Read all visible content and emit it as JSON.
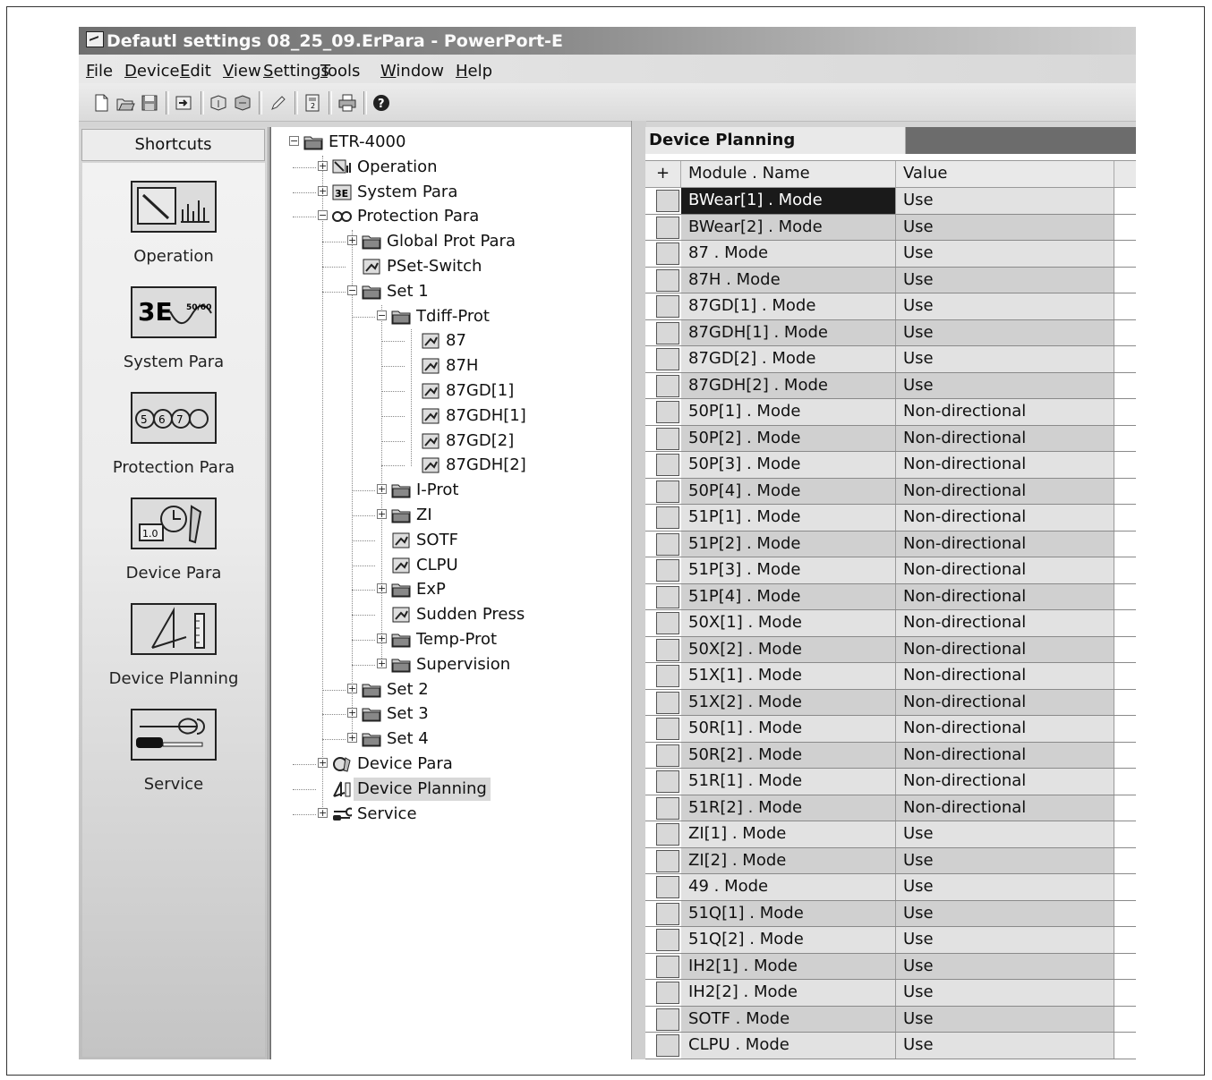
{
  "window": {
    "title": "Defautl settings 08_25_09.ErPara - PowerPort-E"
  },
  "menu": [
    {
      "pre": "",
      "ul": "F",
      "post": "ile"
    },
    {
      "pre": "",
      "ul": "D",
      "post": "evice"
    },
    {
      "pre": "",
      "ul": "E",
      "post": "dit"
    },
    {
      "pre": "",
      "ul": "V",
      "post": "iew"
    },
    {
      "pre": "",
      "ul": "S",
      "post": "ettings"
    },
    {
      "pre": "",
      "ul": "T",
      "post": "ools"
    },
    {
      "pre": "",
      "ul": "W",
      "post": "indow"
    },
    {
      "pre": "",
      "ul": "H",
      "post": "elp"
    }
  ],
  "shortcuts": {
    "header": "Shortcuts",
    "items": [
      {
        "label": "Operation",
        "icon": "operation-icon"
      },
      {
        "label": "System Para",
        "icon": "system-para-icon"
      },
      {
        "label": "Protection Para",
        "icon": "protection-para-icon"
      },
      {
        "label": "Device Para",
        "icon": "device-para-icon"
      },
      {
        "label": "Device Planning",
        "icon": "device-planning-icon"
      },
      {
        "label": "Service",
        "icon": "service-icon"
      }
    ]
  },
  "tree": [
    {
      "label": "ETR-4000",
      "level": 0,
      "exp": "-",
      "icon": "folder"
    },
    {
      "label": "Operation",
      "level": 1,
      "exp": "+",
      "icon": "operation"
    },
    {
      "label": "System Para",
      "level": 1,
      "exp": "+",
      "icon": "system"
    },
    {
      "label": "Protection Para",
      "level": 1,
      "exp": "-",
      "icon": "protection"
    },
    {
      "label": "Global Prot Para",
      "level": 2,
      "exp": "+",
      "icon": "folder"
    },
    {
      "label": "PSet-Switch",
      "level": 2,
      "exp": "",
      "icon": "param"
    },
    {
      "label": "Set 1",
      "level": 2,
      "exp": "-",
      "icon": "folder"
    },
    {
      "label": "Tdiff-Prot",
      "level": 3,
      "exp": "-",
      "icon": "folder"
    },
    {
      "label": "87",
      "level": 4,
      "exp": "",
      "icon": "param"
    },
    {
      "label": "87H",
      "level": 4,
      "exp": "",
      "icon": "param"
    },
    {
      "label": "87GD[1]",
      "level": 4,
      "exp": "",
      "icon": "param"
    },
    {
      "label": "87GDH[1]",
      "level": 4,
      "exp": "",
      "icon": "param"
    },
    {
      "label": "87GD[2]",
      "level": 4,
      "exp": "",
      "icon": "param"
    },
    {
      "label": "87GDH[2]",
      "level": 4,
      "exp": "",
      "icon": "param"
    },
    {
      "label": "I-Prot",
      "level": 3,
      "exp": "+",
      "icon": "folder"
    },
    {
      "label": "ZI",
      "level": 3,
      "exp": "+",
      "icon": "folder"
    },
    {
      "label": "SOTF",
      "level": 3,
      "exp": "",
      "icon": "param"
    },
    {
      "label": "CLPU",
      "level": 3,
      "exp": "",
      "icon": "param"
    },
    {
      "label": "ExP",
      "level": 3,
      "exp": "+",
      "icon": "folder"
    },
    {
      "label": "Sudden Press",
      "level": 3,
      "exp": "",
      "icon": "param"
    },
    {
      "label": "Temp-Prot",
      "level": 3,
      "exp": "+",
      "icon": "folder"
    },
    {
      "label": "Supervision",
      "level": 3,
      "exp": "+",
      "icon": "folder"
    },
    {
      "label": "Set 2",
      "level": 2,
      "exp": "+",
      "icon": "folder"
    },
    {
      "label": "Set 3",
      "level": 2,
      "exp": "+",
      "icon": "folder"
    },
    {
      "label": "Set 4",
      "level": 2,
      "exp": "+",
      "icon": "folder"
    },
    {
      "label": "Device Para",
      "level": 1,
      "exp": "+",
      "icon": "devpara"
    },
    {
      "label": "Device Planning",
      "level": 1,
      "exp": "",
      "icon": "devplan",
      "selected": true
    },
    {
      "label": "Service",
      "level": 1,
      "exp": "+",
      "icon": "service"
    }
  ],
  "grid": {
    "title": "Device Planning",
    "headers": {
      "plus": "+",
      "name": "Module . Name",
      "value": "Value"
    },
    "rows": [
      {
        "name": "BWear[1] . Mode",
        "value": "Use"
      },
      {
        "name": "BWear[2] . Mode",
        "value": "Use"
      },
      {
        "name": "87 . Mode",
        "value": "Use"
      },
      {
        "name": "87H . Mode",
        "value": "Use"
      },
      {
        "name": "87GD[1] . Mode",
        "value": "Use"
      },
      {
        "name": "87GDH[1] . Mode",
        "value": "Use"
      },
      {
        "name": "87GD[2] . Mode",
        "value": "Use"
      },
      {
        "name": "87GDH[2] . Mode",
        "value": "Use"
      },
      {
        "name": "50P[1] . Mode",
        "value": "Non-directional"
      },
      {
        "name": "50P[2] . Mode",
        "value": "Non-directional"
      },
      {
        "name": "50P[3] . Mode",
        "value": "Non-directional"
      },
      {
        "name": "50P[4] . Mode",
        "value": "Non-directional"
      },
      {
        "name": "51P[1] . Mode",
        "value": "Non-directional"
      },
      {
        "name": "51P[2] . Mode",
        "value": "Non-directional"
      },
      {
        "name": "51P[3] . Mode",
        "value": "Non-directional"
      },
      {
        "name": "51P[4] . Mode",
        "value": "Non-directional"
      },
      {
        "name": "50X[1] . Mode",
        "value": "Non-directional"
      },
      {
        "name": "50X[2] . Mode",
        "value": "Non-directional"
      },
      {
        "name": "51X[1] . Mode",
        "value": "Non-directional"
      },
      {
        "name": "51X[2] . Mode",
        "value": "Non-directional"
      },
      {
        "name": "50R[1] . Mode",
        "value": "Non-directional"
      },
      {
        "name": "50R[2] . Mode",
        "value": "Non-directional"
      },
      {
        "name": "51R[1] . Mode",
        "value": "Non-directional"
      },
      {
        "name": "51R[2] . Mode",
        "value": "Non-directional"
      },
      {
        "name": "ZI[1] . Mode",
        "value": "Use"
      },
      {
        "name": "ZI[2] . Mode",
        "value": "Use"
      },
      {
        "name": "49 . Mode",
        "value": "Use"
      },
      {
        "name": "51Q[1] . Mode",
        "value": "Use"
      },
      {
        "name": "51Q[2] . Mode",
        "value": "Use"
      },
      {
        "name": "IH2[1] . Mode",
        "value": "Use"
      },
      {
        "name": "IH2[2] . Mode",
        "value": "Use"
      },
      {
        "name": "SOTF . Mode",
        "value": "Use"
      },
      {
        "name": "CLPU . Mode",
        "value": "Use"
      }
    ]
  }
}
